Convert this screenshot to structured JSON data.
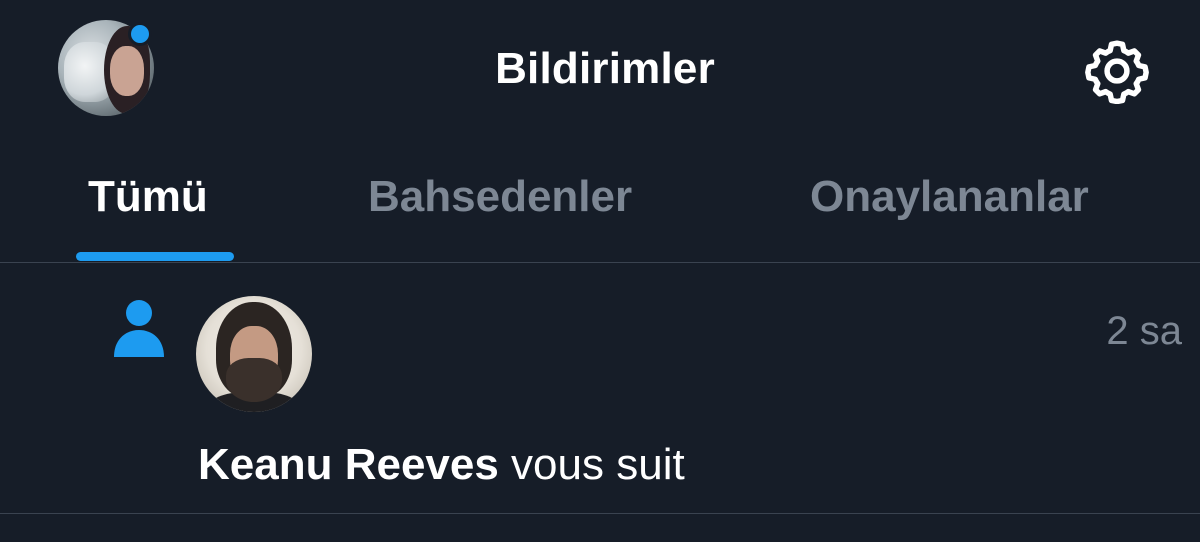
{
  "header": {
    "title": "Bildirimler",
    "avatar_icon": "profile-avatar",
    "settings_icon": "gear-icon"
  },
  "tabs": [
    {
      "label": "Tümü",
      "active": true
    },
    {
      "label": "Bahsedenler",
      "active": false
    },
    {
      "label": "Onaylananlar",
      "active": false
    }
  ],
  "notifications": [
    {
      "type_icon": "person-icon",
      "user_name": "Keanu Reeves",
      "action": " vous suit",
      "time": "2 sa"
    }
  ],
  "colors": {
    "background": "#161d28",
    "accent": "#1d9bf0",
    "muted_text": "#7d8794",
    "divider": "#3a4350"
  }
}
